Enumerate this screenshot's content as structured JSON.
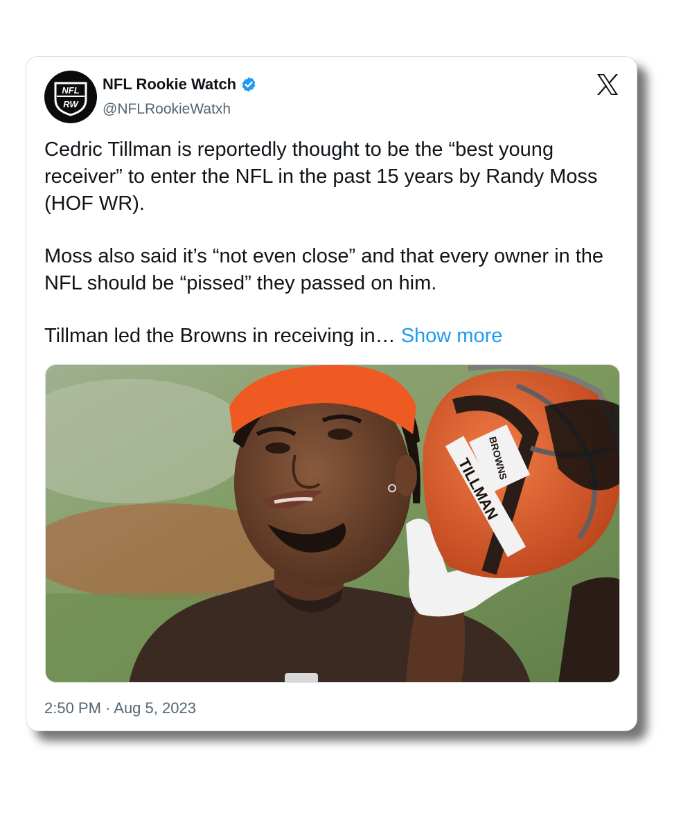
{
  "author": {
    "display_name": "NFL Rookie Watch",
    "handle": "@NFLRookieWatxh",
    "verified": true,
    "avatar_icon": "nfl-rw-logo",
    "avatar_logo_top": "NFL",
    "avatar_logo_bottom": "RW"
  },
  "header": {
    "platform_icon": "x-logo-icon"
  },
  "tweet": {
    "paragraphs": [
      "Cedric Tillman is reportedly thought to be the “best young receiver” to enter the NFL in the past 15 years by Randy Moss (HOF WR).",
      "Moss also said it’s “not even close” and that every owner in the NFL should be “pissed” they passed on him."
    ],
    "truncated_line": "Tillman led the Browns in receiving in…",
    "show_more_label": "Show more"
  },
  "media": {
    "helmet_nameplate": "TILLMAN",
    "helmet_team_label": "BROWNS"
  },
  "meta": {
    "timestamp": "2:50 PM · Aug 5, 2023"
  },
  "colors": {
    "link": "#1d9bf0",
    "verified_badge": "#1d9bf0",
    "text_primary": "#0f1419",
    "text_secondary": "#536471",
    "browns_orange": "#e2531f",
    "browns_brown": "#3b2a21"
  }
}
